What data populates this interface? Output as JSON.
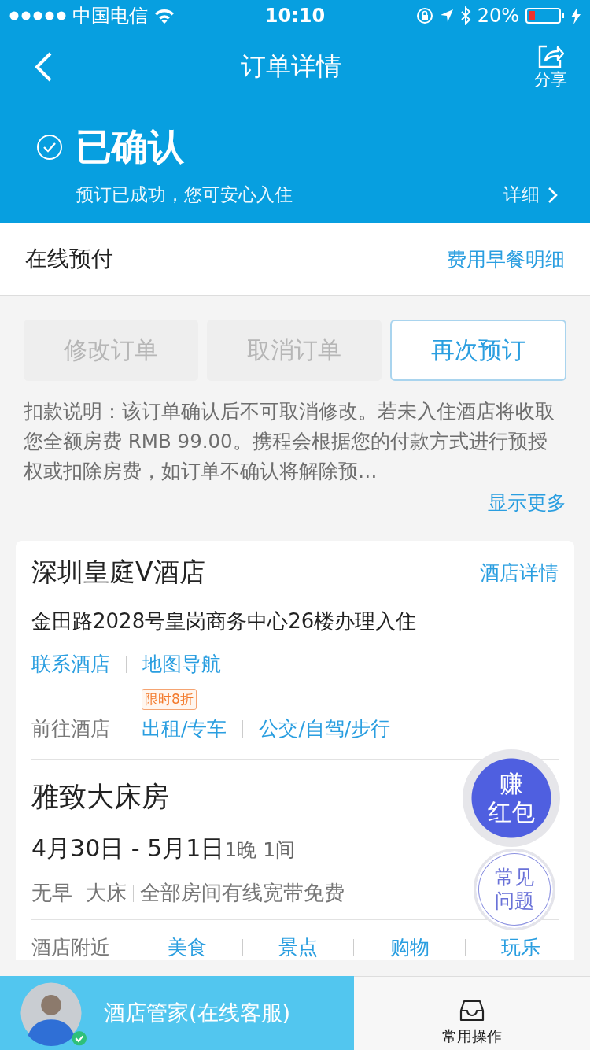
{
  "status_bar": {
    "carrier": "中国电信",
    "time": "10:10",
    "battery": "20%"
  },
  "nav": {
    "title": "订单详情",
    "share": "分享"
  },
  "order_status": {
    "title": "已确认",
    "subtitle": "预订已成功，您可安心入住",
    "detail_link": "详细"
  },
  "payment": {
    "label": "在线预付",
    "link": "费用早餐明细"
  },
  "actions": [
    {
      "label": "修改订单",
      "disabled": true
    },
    {
      "label": "取消订单",
      "disabled": true
    },
    {
      "label": "再次预订",
      "disabled": false
    }
  ],
  "notice": "扣款说明：该订单确认后不可取消修改。若未入住酒店将收取您全额房费 RMB 99.00。携程会根据您的付款方式进行预授权或扣除房费，如订单不确认将解除预…",
  "show_more": "显示更多",
  "hotel": {
    "name": "深圳皇庭V酒店",
    "detail_link": "酒店详情",
    "address": "金田路2028号皇岗商务中心26楼办理入住",
    "links": [
      "联系酒店",
      "地图导航"
    ],
    "transport": {
      "label": "前往酒店",
      "badge": "限时8折",
      "options": [
        "出租/专车",
        "公交/自驾/步行"
      ]
    }
  },
  "room": {
    "name": "雅致大床房",
    "dates": "4月30日 - 5月1日",
    "nights": "1晚 1间",
    "tags": [
      "无早",
      "大床",
      "全部房间有线宽带免费"
    ]
  },
  "nearby": {
    "label": "酒店附近",
    "options": [
      "美食",
      "景点",
      "购物",
      "玩乐"
    ]
  },
  "floating": [
    {
      "kind": "redpacket",
      "lines": [
        "赚",
        "红包"
      ]
    },
    {
      "kind": "faq",
      "lines": [
        "常见",
        "问题"
      ]
    }
  ],
  "bottom_bar": {
    "service": "酒店管家(在线客服)",
    "online": true,
    "menu": "常用操作"
  }
}
